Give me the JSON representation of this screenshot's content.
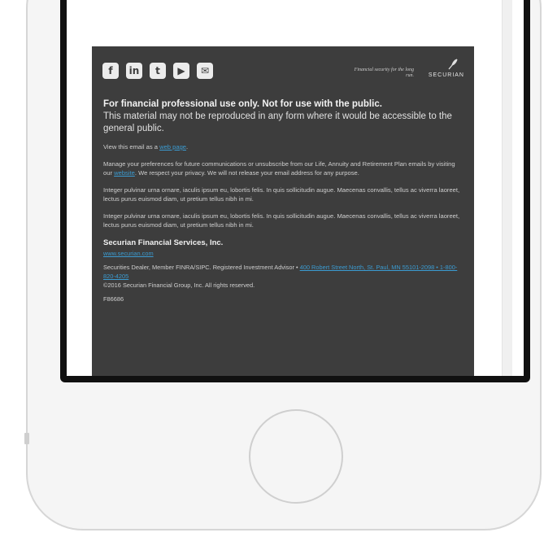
{
  "social": [
    {
      "icon": "facebook-icon",
      "glyph": "f"
    },
    {
      "icon": "linkedin-icon",
      "glyph": "in"
    },
    {
      "icon": "twitter-icon",
      "glyph": "t"
    },
    {
      "icon": "youtube-icon",
      "glyph": "▶"
    },
    {
      "icon": "email-icon",
      "glyph": "✉"
    }
  ],
  "brand": {
    "tagline": "Financial security for the long run.",
    "name": "SECURIAN"
  },
  "footer": {
    "headline": "For financial professional use only. Not for use with the public.",
    "subline": "This material may not be reproduced in any form where it would be accessible to the general public.",
    "view_text": "View this email as a",
    "view_link": "web page",
    "view_suffix": ".",
    "prefs_text": "Manage your preferences for future communications or unsubscribe from our Life, Annuity and Retirement Plan emails by visiting our",
    "prefs_link": "website",
    "prefs_suffix": ". We respect your privacy. We will not release your email address for any purpose.",
    "lorem_1": "Integer pulvinar urna ornare, iaculis ipsum eu, lobortis felis. In quis sollicitudin augue. Maecenas convallis, tellus ac viverra laoreet, lectus purus euismod diam, ut pretium tellus nibh in mi.",
    "lorem_2": "Integer pulvinar urna ornare, iaculis ipsum eu, lobortis felis. In quis sollicitudin augue. Maecenas convallis, tellus ac viverra laoreet, lectus purus euismod diam, ut pretium tellus nibh in mi.",
    "company": "Securian Financial Services, Inc.",
    "company_link": "www.securian.com",
    "dealer_text": "Securities Dealer, Member FINRA/SIPC. Registered Investment Advisor •",
    "dealer_link": "400 Robert Street North, St. Paul, MN 55101-2098 • 1-800-820-4205",
    "copyright": "©2016 Securian Financial Group, Inc. All rights reserved.",
    "code": "F86686"
  }
}
